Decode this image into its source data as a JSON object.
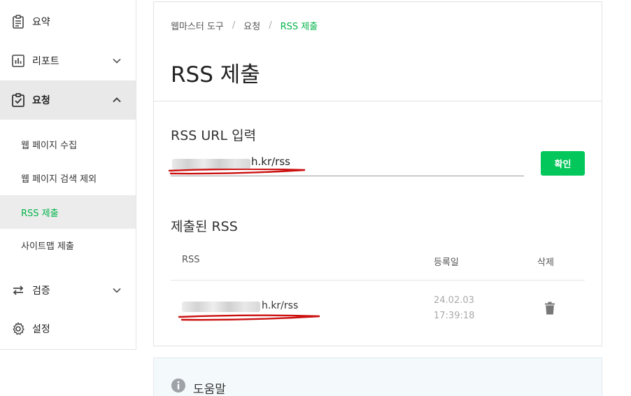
{
  "sidebar": {
    "items": [
      {
        "label": "요약",
        "icon": "clipboard-icon"
      },
      {
        "label": "리포트",
        "icon": "bar-chart-icon"
      },
      {
        "label": "요청",
        "icon": "clipboard-check-icon"
      },
      {
        "label": "검증",
        "icon": "swap-arrows-icon"
      },
      {
        "label": "설정",
        "icon": "gear-icon"
      }
    ],
    "sub_items": [
      {
        "label": "웹 페이지 수집"
      },
      {
        "label": "웹 페이지 검색 제외"
      },
      {
        "label": "RSS 제출"
      },
      {
        "label": "사이트맵 제출"
      }
    ]
  },
  "breadcrumb": [
    "웹마스터 도구",
    "요청",
    "RSS 제출"
  ],
  "page_title": "RSS 제출",
  "rss_input": {
    "section_title": "RSS URL 입력",
    "value_suffix": "h.kr/rss",
    "button_label": "확인"
  },
  "submitted": {
    "section_title": "제출된 RSS",
    "columns": [
      "RSS",
      "등록일",
      "삭제"
    ],
    "rows": [
      {
        "rss_suffix": "h.kr/rss",
        "date": "24.02.03 17:39:18"
      }
    ]
  },
  "help": {
    "title": "도움말"
  },
  "colors": {
    "accent": "#03c75a",
    "accent_text": "#03b44a",
    "annotation": "#cc1111"
  }
}
